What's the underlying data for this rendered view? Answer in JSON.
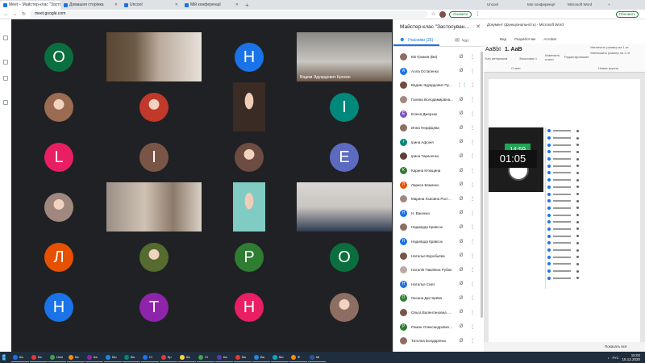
{
  "browser": {
    "tabs": [
      {
        "label": "Meet – Майстер-клас \"Застосув...",
        "active": true
      },
      {
        "label": "Домашня сторінка",
        "active": false
      },
      {
        "label": "Uncool",
        "active": false
      },
      {
        "label": "Мій конференції",
        "active": false
      }
    ],
    "url": "meet.google.com",
    "update_label": "Оновити"
  },
  "meet": {
    "video_label": "Вадим Эдуардович Крохин",
    "panel_title": "Майстер-клас \"Застосування о...",
    "participants_tab": "Учасники (25)",
    "chat_tab": "Чат"
  },
  "participants": [
    {
      "name": "ЕВ Грамов (Ви)",
      "initial": "",
      "color": "#8d6e63",
      "mic": "muted"
    },
    {
      "name": "Алла Остапенко",
      "initial": "А",
      "color": "#1a73e8",
      "mic": "muted"
    },
    {
      "name": "Вадим Эдуардович Пу...",
      "initial": "",
      "color": "#6d4c41",
      "mic": "on"
    },
    {
      "name": "Галина Володимирівна...",
      "initial": "",
      "color": "#a1887f",
      "mic": "muted"
    },
    {
      "name": "Елена Джерзак",
      "initial": "Е",
      "color": "#7e57c2",
      "mic": "muted"
    },
    {
      "name": "Инна Нерфіцева",
      "initial": "",
      "color": "#8d6e63",
      "mic": "muted"
    },
    {
      "name": "Ірина Афонія",
      "initial": "І",
      "color": "#00897b",
      "mic": "muted"
    },
    {
      "name": "Ірина Тарасенко",
      "initial": "",
      "color": "#5d4037",
      "mic": "muted"
    },
    {
      "name": "Карина Кіткіщина",
      "initial": "К",
      "color": "#2e7d32",
      "mic": "muted"
    },
    {
      "name": "Лариса Беманко",
      "initial": "Л",
      "color": "#e65100",
      "mic": "muted"
    },
    {
      "name": "Марина Львовна Росто...",
      "initial": "",
      "color": "#a1887f",
      "mic": "muted"
    },
    {
      "name": "Н. Ваєенко",
      "initial": "Н",
      "color": "#1a73e8",
      "mic": "muted"
    },
    {
      "name": "Надиярда Кравсок",
      "initial": "",
      "color": "#8d6e63",
      "mic": "muted"
    },
    {
      "name": "Надиярда Кравсок",
      "initial": "Н",
      "color": "#1a73e8",
      "mic": "muted"
    },
    {
      "name": "Наталья Воробьёва",
      "initial": "",
      "color": "#795548",
      "mic": "muted"
    },
    {
      "name": "Наталія Павлівна Рубан",
      "initial": "",
      "color": "#bcaaa4",
      "mic": "muted"
    },
    {
      "name": "Наталья Сиез",
      "initial": "Н",
      "color": "#1a73e8",
      "mic": "muted"
    },
    {
      "name": "Оксана Дегтярёва",
      "initial": "О",
      "color": "#2e7d32",
      "mic": "muted"
    },
    {
      "name": "Ольга Валентиновна Ю...",
      "initial": "",
      "color": "#795548",
      "mic": "muted"
    },
    {
      "name": "Роман Олександрович...",
      "initial": "Р",
      "color": "#2e7d32",
      "mic": "muted"
    },
    {
      "name": "Татьяна Бондаренко",
      "initial": "",
      "color": "#8d6e63",
      "mic": "muted"
    }
  ],
  "tiles": [
    {
      "type": "circle",
      "letter": "О",
      "color": "#0b6e3f"
    },
    {
      "type": "video",
      "scene": "room-woman"
    },
    {
      "type": "circle",
      "letter": "Н",
      "color": "#1a73e8"
    },
    {
      "type": "video",
      "scene": "room-man",
      "label": true
    },
    {
      "type": "photo",
      "color": "#9b6b52"
    },
    {
      "type": "photo",
      "color": "#c0392b"
    },
    {
      "type": "portrait",
      "color": "#3a2b25"
    },
    {
      "type": "circle",
      "letter": "І",
      "color": "#00897b"
    },
    {
      "type": "circle",
      "letter": "L",
      "color": "#e91e63"
    },
    {
      "type": "circle",
      "letter": "І",
      "color": "#795548"
    },
    {
      "type": "photo",
      "color": "#6d4c41"
    },
    {
      "type": "circle",
      "letter": "Е",
      "color": "#5c6bc0"
    },
    {
      "type": "photo",
      "color": "#a1887f"
    },
    {
      "type": "video",
      "scene": "office-woman"
    },
    {
      "type": "portrait",
      "color": "#80cbc4"
    },
    {
      "type": "video",
      "scene": "man-suit"
    },
    {
      "type": "circle",
      "letter": "Л",
      "color": "#e65100"
    },
    {
      "type": "photo",
      "color": "#556b2f"
    },
    {
      "type": "circle",
      "letter": "Р",
      "color": "#2e7d32"
    },
    {
      "type": "circle",
      "letter": "О",
      "color": "#0b6e3f"
    },
    {
      "type": "circle",
      "letter": "Н",
      "color": "#1a73e8"
    },
    {
      "type": "circle",
      "letter": "Т",
      "color": "#8e24aa"
    },
    {
      "type": "circle",
      "letter": "Н",
      "color": "#e91e63"
    },
    {
      "type": "photo",
      "color": "#8d6e63"
    }
  ],
  "word": {
    "tabs": [
      "Uncool",
      "Мої конференції",
      "Microsoft Word",
      "+"
    ],
    "update_label": "Обновить",
    "title": "Документ (функціональність) - Microsoft Word",
    "menu": [
      "Вид",
      "Разработчик",
      "Acrobat"
    ],
    "style_sample": "AaBbI",
    "style_heading": "1. AaB",
    "style_names": [
      "Без интервала",
      "Заголовок 1"
    ],
    "change_styles": "Изменить стили",
    "editing": "Редактирование",
    "increase_size": "Увеличить размер на 1 пт",
    "decrease_size": "Уменьшить размер на 1 пт",
    "styles_group": "Стили",
    "new_group": "Новая группа",
    "clock_digital": "14:59",
    "countdown": "01:05",
    "status_right": "Показать все"
  },
  "taskbar": {
    "items": [
      {
        "label": "Ка",
        "color": "#1a73e8"
      },
      {
        "label": "Ка",
        "color": "#e53935"
      },
      {
        "label": "Uncl",
        "color": "#43a047"
      },
      {
        "label": "Ка",
        "color": "#fb8c00"
      },
      {
        "label": "Ка",
        "color": "#8e24aa"
      },
      {
        "label": "Мо",
        "color": "#1e88e5"
      },
      {
        "label": "Ва",
        "color": "#00897b"
      },
      {
        "label": "Cl",
        "color": "#1a73e8"
      },
      {
        "label": "Кр",
        "color": "#e53935"
      },
      {
        "label": "Ка",
        "color": "#fdd835"
      },
      {
        "label": "Cl",
        "color": "#43a047"
      },
      {
        "label": "Ка",
        "color": "#5e35b1"
      },
      {
        "label": "Ва",
        "color": "#e53935"
      },
      {
        "label": "Ва",
        "color": "#1e88e5"
      },
      {
        "label": "Мо",
        "color": "#00acc1"
      },
      {
        "label": "Ф",
        "color": "#fb8c00"
      },
      {
        "label": "Мі",
        "color": "#2b579a"
      }
    ],
    "lang": "РУС",
    "time": "15:02",
    "date": "15.12.2020"
  }
}
